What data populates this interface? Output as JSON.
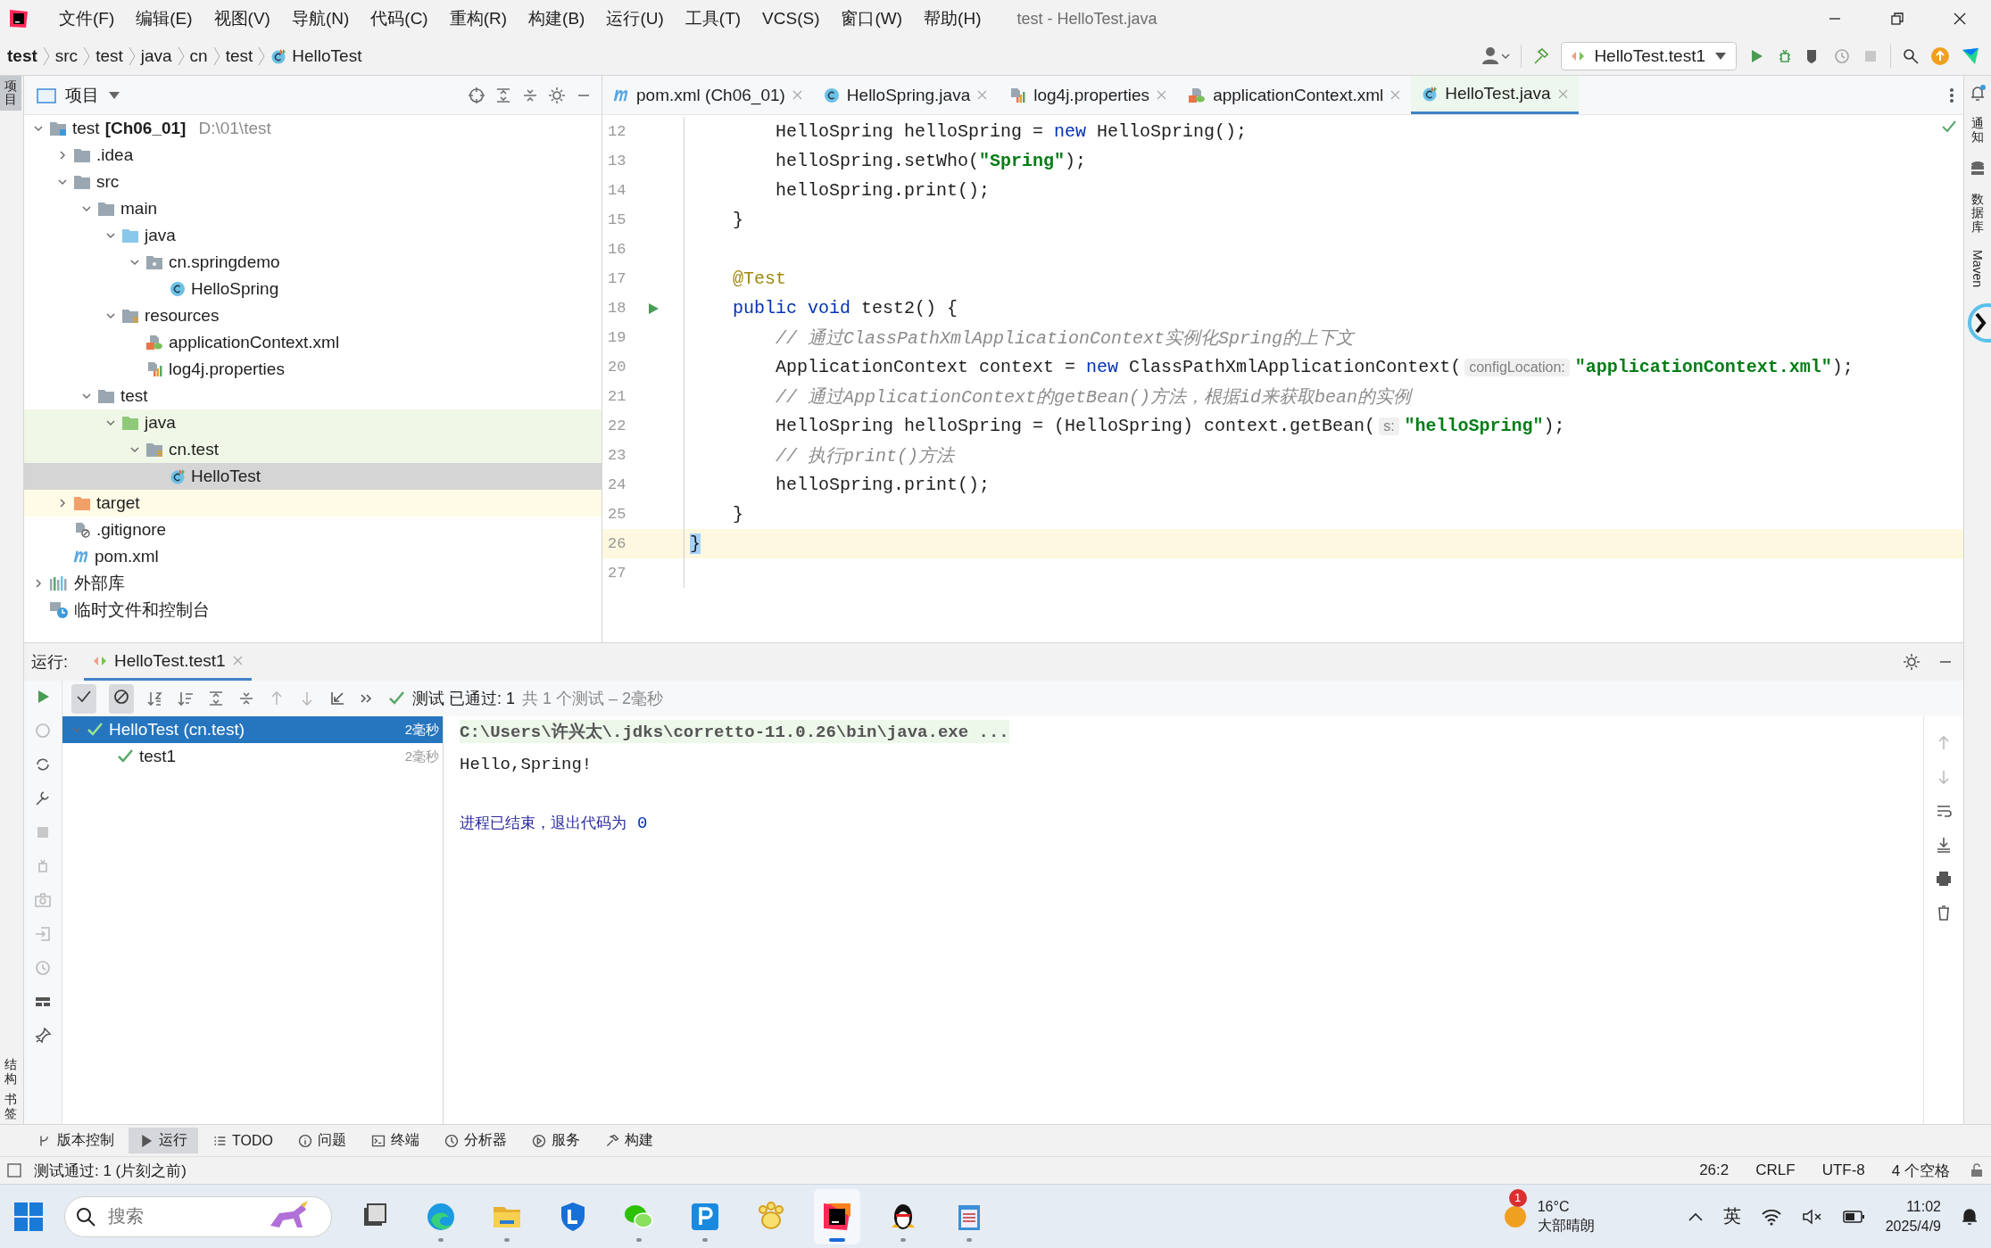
{
  "menu": {
    "items": [
      "文件(F)",
      "编辑(E)",
      "视图(V)",
      "导航(N)",
      "代码(C)",
      "重构(R)",
      "构建(B)",
      "运行(U)",
      "工具(T)",
      "VCS(S)",
      "窗口(W)",
      "帮助(H)"
    ],
    "title": "test - HelloTest.java"
  },
  "breadcrumb": [
    {
      "label": "test",
      "bold": true,
      "kind": "text"
    },
    {
      "label": "src",
      "bold": false,
      "kind": "text"
    },
    {
      "label": "test",
      "bold": false,
      "kind": "text"
    },
    {
      "label": "java",
      "bold": false,
      "kind": "text"
    },
    {
      "label": "cn",
      "bold": false,
      "kind": "text"
    },
    {
      "label": "test",
      "bold": false,
      "kind": "text"
    },
    {
      "label": "HelloTest",
      "bold": false,
      "kind": "test-class"
    }
  ],
  "run_config": "HelloTest.test1",
  "project_panel": {
    "title": "项目"
  },
  "left_stripe": {
    "top": [
      "项目"
    ],
    "bottom": [
      "结构",
      "书签"
    ]
  },
  "right_stripe": [
    "通知",
    "数据库",
    "Maven"
  ],
  "tree": [
    {
      "label": "test",
      "module": "[Ch06_01]",
      "path": "D:\\01\\test",
      "kind": "module",
      "expanded": true,
      "selected": false,
      "children": [
        {
          "label": ".idea",
          "kind": "folder",
          "expanded": false,
          "selected": false
        },
        {
          "label": "src",
          "kind": "folder",
          "expanded": true,
          "selected": false,
          "children": [
            {
              "label": "main",
              "kind": "folder",
              "expanded": true,
              "selected": false,
              "children": [
                {
                  "label": "java",
                  "kind": "folder-src",
                  "expanded": true,
                  "selected": false,
                  "children": [
                    {
                      "label": "cn.springdemo",
                      "kind": "package",
                      "expanded": true,
                      "selected": false,
                      "children": [
                        {
                          "label": "HelloSpring",
                          "kind": "class",
                          "selected": false
                        }
                      ]
                    }
                  ]
                },
                {
                  "label": "resources",
                  "kind": "folder-res",
                  "expanded": true,
                  "selected": false,
                  "children": [
                    {
                      "label": "applicationContext.xml",
                      "kind": "xml",
                      "selected": false
                    },
                    {
                      "label": "log4j.properties",
                      "kind": "props",
                      "selected": false
                    }
                  ]
                }
              ]
            },
            {
              "label": "test",
              "kind": "folder",
              "expanded": true,
              "selected": false,
              "children": [
                {
                  "label": "java",
                  "kind": "folder-test",
                  "expanded": true,
                  "selected": false,
                  "children": [
                    {
                      "label": "cn.test",
                      "kind": "package-test",
                      "expanded": true,
                      "selected": false,
                      "children": [
                        {
                          "label": "HelloTest",
                          "kind": "test-class",
                          "selected": true
                        }
                      ]
                    }
                  ]
                }
              ]
            }
          ]
        },
        {
          "label": "target",
          "kind": "folder-excluded",
          "expanded": false,
          "selected": false
        },
        {
          "label": ".gitignore",
          "kind": "gitignore",
          "selected": false
        },
        {
          "label": "pom.xml",
          "kind": "maven",
          "selected": false
        }
      ]
    },
    {
      "label": "外部库",
      "kind": "library",
      "expanded": false,
      "selected": false
    },
    {
      "label": "临时文件和控制台",
      "kind": "scratch",
      "selected": false
    }
  ],
  "editor_tabs": [
    {
      "label": "pom.xml (Ch06_01)",
      "kind": "maven",
      "selected": false
    },
    {
      "label": "HelloSpring.java",
      "kind": "class",
      "selected": false
    },
    {
      "label": "log4j.properties",
      "kind": "props",
      "selected": false
    },
    {
      "label": "applicationContext.xml",
      "kind": "xml",
      "selected": false
    },
    {
      "label": "HelloTest.java",
      "kind": "test-class",
      "selected": true
    }
  ],
  "code": [
    {
      "number": "12",
      "current": false,
      "runnable": false,
      "tokens": [
        {
          "kind": "plain",
          "text": "        HelloSpring helloSpring = "
        },
        {
          "kind": "keyword",
          "text": "new"
        },
        {
          "kind": "plain",
          "text": " HelloSpring();"
        }
      ]
    },
    {
      "number": "13",
      "current": false,
      "runnable": false,
      "tokens": [
        {
          "kind": "plain",
          "text": "        helloSpring.setWho("
        },
        {
          "kind": "string",
          "text": "\"Spring\""
        },
        {
          "kind": "plain",
          "text": ");"
        }
      ]
    },
    {
      "number": "14",
      "current": false,
      "runnable": false,
      "tokens": [
        {
          "kind": "plain",
          "text": "        helloSpring.print();"
        }
      ]
    },
    {
      "number": "15",
      "current": false,
      "runnable": false,
      "tokens": [
        {
          "kind": "plain",
          "text": "    }"
        }
      ]
    },
    {
      "number": "16",
      "current": false,
      "runnable": false
    },
    {
      "number": "17",
      "current": false,
      "runnable": false,
      "tokens": [
        {
          "kind": "annotation",
          "text": "    @Test"
        }
      ]
    },
    {
      "number": "18",
      "current": false,
      "runnable": true,
      "tokens": [
        {
          "kind": "keyword",
          "text": "    public void"
        },
        {
          "kind": "plain",
          "text": " test2() {"
        }
      ]
    },
    {
      "number": "19",
      "current": false,
      "runnable": false,
      "tokens": [
        {
          "kind": "comment",
          "text": "        // 通过ClassPathXmlApplicationContext实例化Spring的上下文"
        }
      ]
    },
    {
      "number": "20",
      "current": false,
      "runnable": false,
      "tokens": [
        {
          "kind": "plain",
          "text": "        ApplicationContext context = "
        },
        {
          "kind": "keyword",
          "text": "new"
        },
        {
          "kind": "plain",
          "text": " ClassPathXmlApplicationContext("
        },
        {
          "kind": "hint",
          "text": "configLocation:"
        },
        {
          "kind": "string",
          "text": "\"applicationContext.xml\""
        },
        {
          "kind": "plain",
          "text": ");"
        }
      ]
    },
    {
      "number": "21",
      "current": false,
      "runnable": false,
      "tokens": [
        {
          "kind": "comment",
          "text": "        // 通过ApplicationContext的getBean()方法，根据id来获取bean的实例"
        }
      ]
    },
    {
      "number": "22",
      "current": false,
      "runnable": false,
      "tokens": [
        {
          "kind": "plain",
          "text": "        HelloSpring helloSpring = (HelloSpring) context.getBean("
        },
        {
          "kind": "hint",
          "text": "s:"
        },
        {
          "kind": "string",
          "text": "\"helloSpring\""
        },
        {
          "kind": "plain",
          "text": ");"
        }
      ]
    },
    {
      "number": "23",
      "current": false,
      "runnable": false,
      "tokens": [
        {
          "kind": "comment",
          "text": "        // 执行print()方法"
        }
      ]
    },
    {
      "number": "24",
      "current": false,
      "runnable": false,
      "tokens": [
        {
          "kind": "plain",
          "text": "        helloSpring.print();"
        }
      ]
    },
    {
      "number": "25",
      "current": false,
      "runnable": false,
      "tokens": [
        {
          "kind": "plain",
          "text": "    }"
        }
      ]
    },
    {
      "number": "26",
      "current": true,
      "runnable": false,
      "tokens": [
        {
          "kind": "brace",
          "text": "}"
        }
      ]
    },
    {
      "number": "27",
      "current": false,
      "runnable": false
    }
  ],
  "run_panel": {
    "label": "运行:",
    "tab": "HelloTest.test1",
    "passed": "测试 已通过: 1",
    "summary": "共 1 个测试 – 2毫秒",
    "tests": [
      {
        "label": "HelloTest (cn.test)",
        "time": "2毫秒",
        "selected": true,
        "expanded": true,
        "children": [
          {
            "label": "test1",
            "time": "2毫秒",
            "selected": false
          }
        ]
      }
    ],
    "console": [
      {
        "kind": "command",
        "text": "C:\\Users\\许兴太\\.jdks\\corretto-11.0.26\\bin\\java.exe ..."
      },
      {
        "kind": "output",
        "text": "Hello,Spring!"
      },
      {
        "kind": "blank"
      },
      {
        "kind": "exit",
        "text": "进程已结束，退出代码为",
        "code": "0"
      }
    ]
  },
  "tool_tabs": [
    {
      "label": "版本控制",
      "kind": "branch",
      "selected": false
    },
    {
      "label": "运行",
      "kind": "play",
      "selected": true
    },
    {
      "label": "TODO",
      "kind": "list",
      "selected": false
    },
    {
      "label": "问题",
      "kind": "info",
      "selected": false
    },
    {
      "label": "终端",
      "kind": "terminal",
      "selected": false
    },
    {
      "label": "分析器",
      "kind": "profiler",
      "selected": false
    },
    {
      "label": "服务",
      "kind": "services",
      "selected": false
    },
    {
      "label": "构建",
      "kind": "hammer",
      "selected": false
    }
  ],
  "status_bar": {
    "message": "测试通过: 1 (片刻之前)",
    "items": [
      "26:2",
      "CRLF",
      "UTF-8",
      "4 个空格"
    ]
  },
  "taskbar": {
    "search": {
      "placeholder": "搜索"
    },
    "apps": [
      {
        "kind": "window",
        "running": false,
        "active": false
      },
      {
        "kind": "edge",
        "running": true,
        "active": false
      },
      {
        "kind": "explorer",
        "running": true,
        "active": false
      },
      {
        "kind": "shield",
        "running": false,
        "active": false
      },
      {
        "kind": "chat",
        "running": true,
        "active": false
      },
      {
        "kind": "p",
        "running": true,
        "active": false
      },
      {
        "kind": "paw",
        "running": false,
        "active": false
      },
      {
        "kind": "ide",
        "running": true,
        "active": true
      },
      {
        "kind": "penguin",
        "running": true,
        "active": false
      },
      {
        "kind": "notepad",
        "running": true,
        "active": false
      }
    ],
    "weather": {
      "temp": "16°C",
      "text": "大部晴朗",
      "badge": "1"
    },
    "ime": "英",
    "time": "11:02",
    "date": "2025/4/9"
  }
}
